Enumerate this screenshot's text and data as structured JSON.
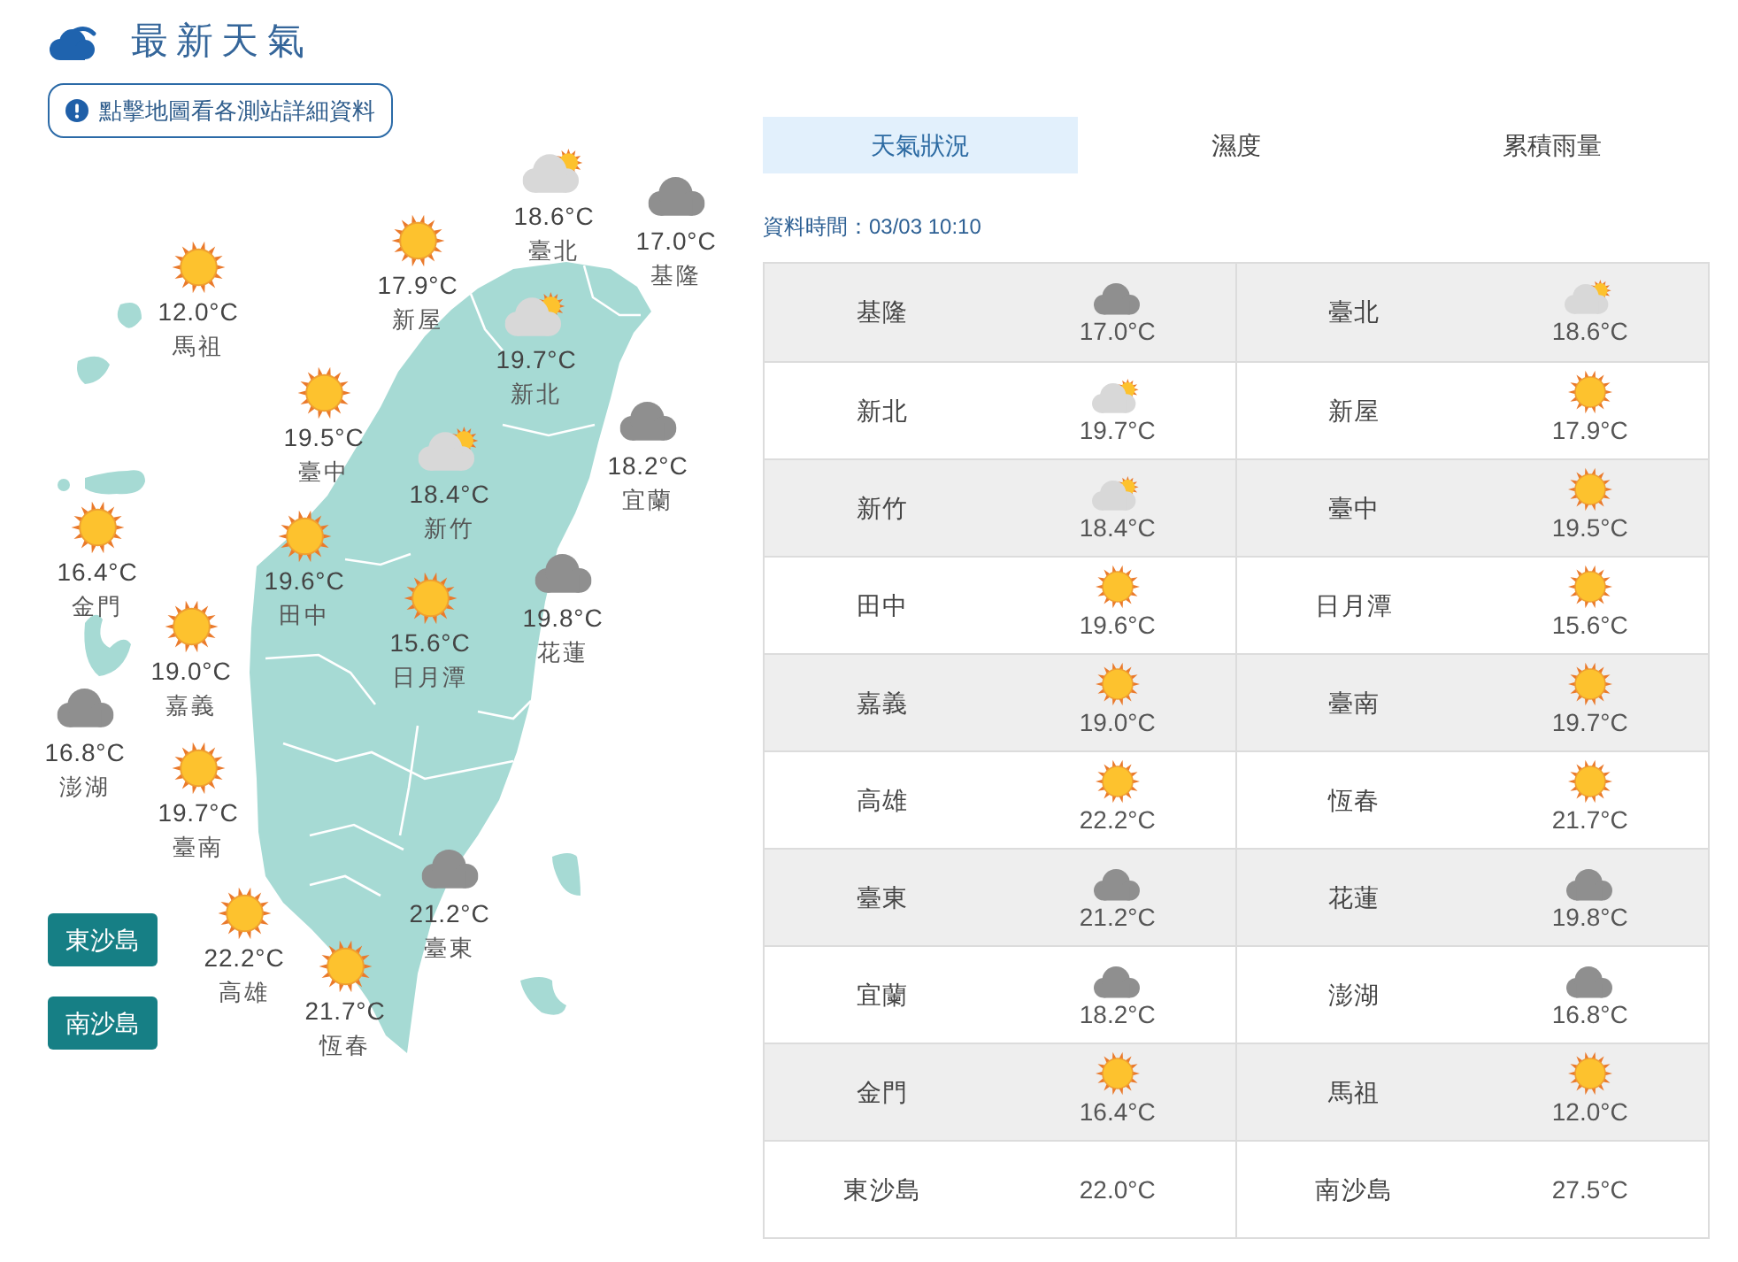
{
  "header": {
    "title": "最新天氣"
  },
  "map_hint": {
    "text": "點擊地圖看各測站詳細資料"
  },
  "map": {
    "stations": [
      {
        "name": "臺北",
        "kind": "partly_cloudy",
        "temperature": "18.6°C"
      },
      {
        "name": "基隆",
        "kind": "cloudy",
        "temperature": "17.0°C"
      },
      {
        "name": "馬祖",
        "kind": "sunny",
        "temperature": "12.0°C"
      },
      {
        "name": "新屋",
        "kind": "sunny",
        "temperature": "17.9°C"
      },
      {
        "name": "新北",
        "kind": "partly_cloudy",
        "temperature": "19.7°C"
      },
      {
        "name": "臺中",
        "kind": "sunny",
        "temperature": "19.5°C"
      },
      {
        "name": "宜蘭",
        "kind": "cloudy",
        "temperature": "18.2°C"
      },
      {
        "name": "新竹",
        "kind": "partly_cloudy",
        "temperature": "18.4°C"
      },
      {
        "name": "金門",
        "kind": "sunny",
        "temperature": "16.4°C"
      },
      {
        "name": "田中",
        "kind": "sunny",
        "temperature": "19.6°C"
      },
      {
        "name": "花蓮",
        "kind": "cloudy",
        "temperature": "19.8°C"
      },
      {
        "name": "日月潭",
        "kind": "sunny",
        "temperature": "15.6°C"
      },
      {
        "name": "嘉義",
        "kind": "sunny",
        "temperature": "19.0°C"
      },
      {
        "name": "澎湖",
        "kind": "cloudy",
        "temperature": "16.8°C"
      },
      {
        "name": "臺南",
        "kind": "sunny",
        "temperature": "19.7°C"
      },
      {
        "name": "臺東",
        "kind": "cloudy",
        "temperature": "21.2°C"
      },
      {
        "name": "高雄",
        "kind": "sunny",
        "temperature": "22.2°C"
      },
      {
        "name": "恆春",
        "kind": "sunny",
        "temperature": "21.7°C"
      }
    ],
    "island_buttons": [
      "東沙島",
      "南沙島"
    ]
  },
  "tabs": [
    {
      "label": "天氣狀況",
      "selected": true
    },
    {
      "label": "濕度",
      "selected": false
    },
    {
      "label": "累積雨量",
      "selected": false
    }
  ],
  "data_time": "資料時間：03/03 10:10",
  "table": {
    "rows": [
      {
        "cells": [
          {
            "station": "基隆",
            "kind": "cloudy",
            "temperature": "17.0°C"
          },
          {
            "station": "臺北",
            "kind": "partly_cloudy",
            "temperature": "18.6°C"
          }
        ]
      },
      {
        "cells": [
          {
            "station": "新北",
            "kind": "partly_cloudy",
            "temperature": "19.7°C"
          },
          {
            "station": "新屋",
            "kind": "sunny",
            "temperature": "17.9°C"
          }
        ]
      },
      {
        "cells": [
          {
            "station": "新竹",
            "kind": "partly_cloudy",
            "temperature": "18.4°C"
          },
          {
            "station": "臺中",
            "kind": "sunny",
            "temperature": "19.5°C"
          }
        ]
      },
      {
        "cells": [
          {
            "station": "田中",
            "kind": "sunny",
            "temperature": "19.6°C"
          },
          {
            "station": "日月潭",
            "kind": "sunny",
            "temperature": "15.6°C"
          }
        ]
      },
      {
        "cells": [
          {
            "station": "嘉義",
            "kind": "sunny",
            "temperature": "19.0°C"
          },
          {
            "station": "臺南",
            "kind": "sunny",
            "temperature": "19.7°C"
          }
        ]
      },
      {
        "cells": [
          {
            "station": "高雄",
            "kind": "sunny",
            "temperature": "22.2°C"
          },
          {
            "station": "恆春",
            "kind": "sunny",
            "temperature": "21.7°C"
          }
        ]
      },
      {
        "cells": [
          {
            "station": "臺東",
            "kind": "cloudy",
            "temperature": "21.2°C"
          },
          {
            "station": "花蓮",
            "kind": "cloudy",
            "temperature": "19.8°C"
          }
        ]
      },
      {
        "cells": [
          {
            "station": "宜蘭",
            "kind": "cloudy",
            "temperature": "18.2°C"
          },
          {
            "station": "澎湖",
            "kind": "cloudy",
            "temperature": "16.8°C"
          }
        ]
      },
      {
        "cells": [
          {
            "station": "金門",
            "kind": "sunny",
            "temperature": "16.4°C"
          },
          {
            "station": "馬祖",
            "kind": "sunny",
            "temperature": "12.0°C"
          }
        ]
      },
      {
        "cells": [
          {
            "station": "東沙島",
            "temperature": "22.0°C"
          },
          {
            "station": "南沙島",
            "temperature": "27.5°C"
          }
        ]
      }
    ]
  }
}
